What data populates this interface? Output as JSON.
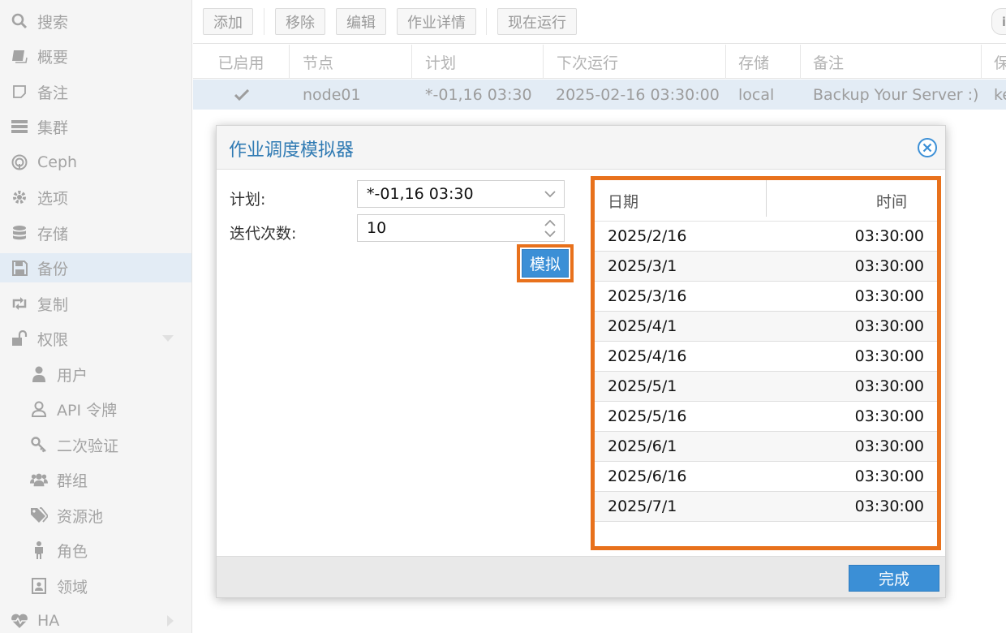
{
  "sidebar": {
    "items": [
      {
        "label": "搜索",
        "icon": "search-icon"
      },
      {
        "label": "概要",
        "icon": "book-icon"
      },
      {
        "label": "备注",
        "icon": "note-icon"
      },
      {
        "label": "集群",
        "icon": "server-icon"
      },
      {
        "label": "Ceph",
        "icon": "ceph-icon"
      },
      {
        "label": "选项",
        "icon": "gear-icon"
      },
      {
        "label": "存储",
        "icon": "database-icon"
      },
      {
        "label": "备份",
        "icon": "floppy-icon"
      },
      {
        "label": "复制",
        "icon": "retweet-icon"
      },
      {
        "label": "权限",
        "icon": "unlock-icon"
      },
      {
        "label": "用户",
        "icon": "user-icon"
      },
      {
        "label": "API 令牌",
        "icon": "user-outline-icon"
      },
      {
        "label": "二次验证",
        "icon": "key-icon"
      },
      {
        "label": "群组",
        "icon": "users-icon"
      },
      {
        "label": "资源池",
        "icon": "tags-icon"
      },
      {
        "label": "角色",
        "icon": "male-icon"
      },
      {
        "label": "领域",
        "icon": "id-card-icon"
      },
      {
        "label": "HA",
        "icon": "heartbeat-icon"
      }
    ],
    "active_index": 7
  },
  "toolbar": {
    "add": "添加",
    "remove": "移除",
    "edit": "编辑",
    "job_detail": "作业详情",
    "run_now": "现在运行"
  },
  "grid": {
    "columns": [
      "已启用",
      "节点",
      "计划",
      "下次运行",
      "存储",
      "备注",
      "保"
    ],
    "row": {
      "enabled": true,
      "node": "node01",
      "schedule": "*-01,16 03:30",
      "next_run": "2025-02-16 03:30:00",
      "storage": "local",
      "note": "Backup Your Server :)",
      "retention": "ke"
    }
  },
  "modal": {
    "title": "作业调度模拟器",
    "schedule_label": "计划:",
    "schedule_value": "*-01,16 03:30",
    "iterations_label": "迭代次数:",
    "iterations_value": "10",
    "simulate_label": "模拟",
    "result_headers": {
      "date": "日期",
      "time": "时间"
    },
    "results": [
      {
        "date": "2025/2/16",
        "time": "03:30:00"
      },
      {
        "date": "2025/3/1",
        "time": "03:30:00"
      },
      {
        "date": "2025/3/16",
        "time": "03:30:00"
      },
      {
        "date": "2025/4/1",
        "time": "03:30:00"
      },
      {
        "date": "2025/4/16",
        "time": "03:30:00"
      },
      {
        "date": "2025/5/1",
        "time": "03:30:00"
      },
      {
        "date": "2025/5/16",
        "time": "03:30:00"
      },
      {
        "date": "2025/6/1",
        "time": "03:30:00"
      },
      {
        "date": "2025/6/16",
        "time": "03:30:00"
      },
      {
        "date": "2025/7/1",
        "time": "03:30:00"
      }
    ],
    "done_label": "完成"
  },
  "colors": {
    "accent": "#3b8fd6",
    "highlight": "#e8711c",
    "selection": "#e3ecf5"
  }
}
